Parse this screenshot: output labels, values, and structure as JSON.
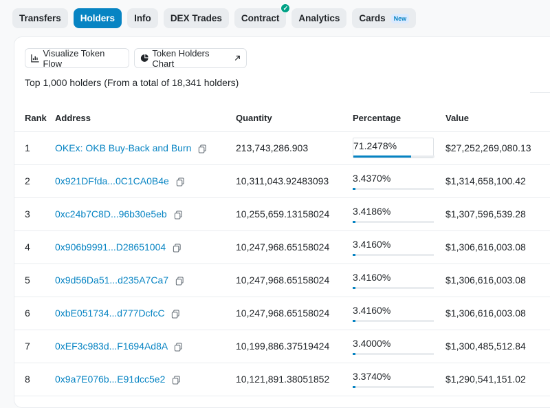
{
  "tabs": [
    {
      "label": "Transfers",
      "active": false
    },
    {
      "label": "Holders",
      "active": true
    },
    {
      "label": "Info",
      "active": false
    },
    {
      "label": "DEX Trades",
      "active": false
    },
    {
      "label": "Contract",
      "active": false,
      "verified_icon": "check-icon"
    },
    {
      "label": "Analytics",
      "active": false
    },
    {
      "label": "Cards",
      "active": false,
      "badge": "New"
    }
  ],
  "toolbar": {
    "visualize_label": "Visualize Token Flow",
    "chart_label": "Token Holders Chart"
  },
  "summary": "Top 1,000 holders (From a total of 18,341 holders)",
  "table": {
    "headers": [
      "Rank",
      "Address",
      "Quantity",
      "Percentage",
      "Value"
    ],
    "rows": [
      {
        "rank": "1",
        "address": "OKEx: OKB Buy-Back and Burn",
        "quantity": "213,743,286.903",
        "percentage": "71.2478%",
        "pct_value": 71.2478,
        "value": "$27,252,269,080.13"
      },
      {
        "rank": "2",
        "address": "0x921DFfda...0C1CA0B4e",
        "quantity": "10,311,043.92483093",
        "percentage": "3.4370%",
        "pct_value": 3.437,
        "value": "$1,314,658,100.42"
      },
      {
        "rank": "3",
        "address": "0xc24b7C8D...96b30e5eb",
        "quantity": "10,255,659.13158024",
        "percentage": "3.4186%",
        "pct_value": 3.4186,
        "value": "$1,307,596,539.28"
      },
      {
        "rank": "4",
        "address": "0x906b9991...D28651004",
        "quantity": "10,247,968.65158024",
        "percentage": "3.4160%",
        "pct_value": 3.416,
        "value": "$1,306,616,003.08"
      },
      {
        "rank": "5",
        "address": "0x9d56Da51...d235A7Ca7",
        "quantity": "10,247,968.65158024",
        "percentage": "3.4160%",
        "pct_value": 3.416,
        "value": "$1,306,616,003.08"
      },
      {
        "rank": "6",
        "address": "0xbE051734...d777DcfcC",
        "quantity": "10,247,968.65158024",
        "percentage": "3.4160%",
        "pct_value": 3.416,
        "value": "$1,306,616,003.08"
      },
      {
        "rank": "7",
        "address": "0xEF3c983d...F1694Ad8A",
        "quantity": "10,199,886.37519424",
        "percentage": "3.4000%",
        "pct_value": 3.4,
        "value": "$1,300,485,512.84"
      },
      {
        "rank": "8",
        "address": "0x9a7E076b...E91dcc5e2",
        "quantity": "10,121,891.38051852",
        "percentage": "3.3740%",
        "pct_value": 3.374,
        "value": "$1,290,541,151.02"
      }
    ]
  },
  "colors": {
    "accent": "#0784c3",
    "verified": "#00a186"
  }
}
